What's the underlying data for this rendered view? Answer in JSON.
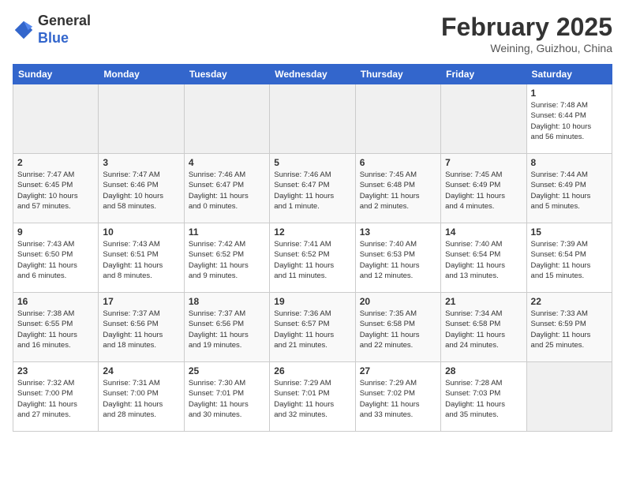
{
  "header": {
    "logo_general": "General",
    "logo_blue": "Blue",
    "month_title": "February 2025",
    "location": "Weining, Guizhou, China"
  },
  "weekdays": [
    "Sunday",
    "Monday",
    "Tuesday",
    "Wednesday",
    "Thursday",
    "Friday",
    "Saturday"
  ],
  "weeks": [
    [
      {
        "day": "",
        "info": ""
      },
      {
        "day": "",
        "info": ""
      },
      {
        "day": "",
        "info": ""
      },
      {
        "day": "",
        "info": ""
      },
      {
        "day": "",
        "info": ""
      },
      {
        "day": "",
        "info": ""
      },
      {
        "day": "1",
        "info": "Sunrise: 7:48 AM\nSunset: 6:44 PM\nDaylight: 10 hours\nand 56 minutes."
      }
    ],
    [
      {
        "day": "2",
        "info": "Sunrise: 7:47 AM\nSunset: 6:45 PM\nDaylight: 10 hours\nand 57 minutes."
      },
      {
        "day": "3",
        "info": "Sunrise: 7:47 AM\nSunset: 6:46 PM\nDaylight: 10 hours\nand 58 minutes."
      },
      {
        "day": "4",
        "info": "Sunrise: 7:46 AM\nSunset: 6:47 PM\nDaylight: 11 hours\nand 0 minutes."
      },
      {
        "day": "5",
        "info": "Sunrise: 7:46 AM\nSunset: 6:47 PM\nDaylight: 11 hours\nand 1 minute."
      },
      {
        "day": "6",
        "info": "Sunrise: 7:45 AM\nSunset: 6:48 PM\nDaylight: 11 hours\nand 2 minutes."
      },
      {
        "day": "7",
        "info": "Sunrise: 7:45 AM\nSunset: 6:49 PM\nDaylight: 11 hours\nand 4 minutes."
      },
      {
        "day": "8",
        "info": "Sunrise: 7:44 AM\nSunset: 6:49 PM\nDaylight: 11 hours\nand 5 minutes."
      }
    ],
    [
      {
        "day": "9",
        "info": "Sunrise: 7:43 AM\nSunset: 6:50 PM\nDaylight: 11 hours\nand 6 minutes."
      },
      {
        "day": "10",
        "info": "Sunrise: 7:43 AM\nSunset: 6:51 PM\nDaylight: 11 hours\nand 8 minutes."
      },
      {
        "day": "11",
        "info": "Sunrise: 7:42 AM\nSunset: 6:52 PM\nDaylight: 11 hours\nand 9 minutes."
      },
      {
        "day": "12",
        "info": "Sunrise: 7:41 AM\nSunset: 6:52 PM\nDaylight: 11 hours\nand 11 minutes."
      },
      {
        "day": "13",
        "info": "Sunrise: 7:40 AM\nSunset: 6:53 PM\nDaylight: 11 hours\nand 12 minutes."
      },
      {
        "day": "14",
        "info": "Sunrise: 7:40 AM\nSunset: 6:54 PM\nDaylight: 11 hours\nand 13 minutes."
      },
      {
        "day": "15",
        "info": "Sunrise: 7:39 AM\nSunset: 6:54 PM\nDaylight: 11 hours\nand 15 minutes."
      }
    ],
    [
      {
        "day": "16",
        "info": "Sunrise: 7:38 AM\nSunset: 6:55 PM\nDaylight: 11 hours\nand 16 minutes."
      },
      {
        "day": "17",
        "info": "Sunrise: 7:37 AM\nSunset: 6:56 PM\nDaylight: 11 hours\nand 18 minutes."
      },
      {
        "day": "18",
        "info": "Sunrise: 7:37 AM\nSunset: 6:56 PM\nDaylight: 11 hours\nand 19 minutes."
      },
      {
        "day": "19",
        "info": "Sunrise: 7:36 AM\nSunset: 6:57 PM\nDaylight: 11 hours\nand 21 minutes."
      },
      {
        "day": "20",
        "info": "Sunrise: 7:35 AM\nSunset: 6:58 PM\nDaylight: 11 hours\nand 22 minutes."
      },
      {
        "day": "21",
        "info": "Sunrise: 7:34 AM\nSunset: 6:58 PM\nDaylight: 11 hours\nand 24 minutes."
      },
      {
        "day": "22",
        "info": "Sunrise: 7:33 AM\nSunset: 6:59 PM\nDaylight: 11 hours\nand 25 minutes."
      }
    ],
    [
      {
        "day": "23",
        "info": "Sunrise: 7:32 AM\nSunset: 7:00 PM\nDaylight: 11 hours\nand 27 minutes."
      },
      {
        "day": "24",
        "info": "Sunrise: 7:31 AM\nSunset: 7:00 PM\nDaylight: 11 hours\nand 28 minutes."
      },
      {
        "day": "25",
        "info": "Sunrise: 7:30 AM\nSunset: 7:01 PM\nDaylight: 11 hours\nand 30 minutes."
      },
      {
        "day": "26",
        "info": "Sunrise: 7:29 AM\nSunset: 7:01 PM\nDaylight: 11 hours\nand 32 minutes."
      },
      {
        "day": "27",
        "info": "Sunrise: 7:29 AM\nSunset: 7:02 PM\nDaylight: 11 hours\nand 33 minutes."
      },
      {
        "day": "28",
        "info": "Sunrise: 7:28 AM\nSunset: 7:03 PM\nDaylight: 11 hours\nand 35 minutes."
      },
      {
        "day": "",
        "info": ""
      }
    ]
  ]
}
